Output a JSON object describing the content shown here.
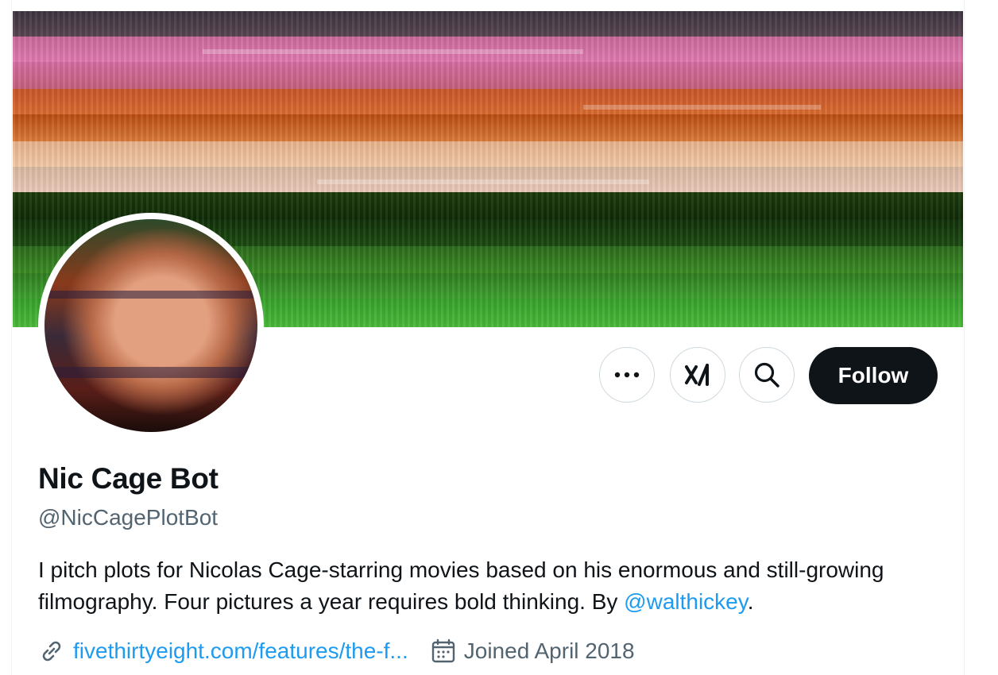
{
  "profile": {
    "name": "Nic Cage Bot",
    "handle": "@NicCagePlotBot",
    "bio_text": "I pitch plots for Nicolas Cage-starring movies based on his enormous and still-growing filmography. Four pictures a year requires bold thinking. By ",
    "bio_mention": "@walthickey",
    "bio_end": ".",
    "website": "fivethirtyeight.com/features/the-f...",
    "joined": "Joined April 2018"
  },
  "actions": {
    "more_icon": "more-horizontal-icon",
    "grok_icon": "grok-icon",
    "search_icon": "search-icon",
    "follow_label": "Follow"
  },
  "colors": {
    "link": "#1d9bf0",
    "follow_bg": "#0f1419",
    "secondary_text": "#536471"
  }
}
